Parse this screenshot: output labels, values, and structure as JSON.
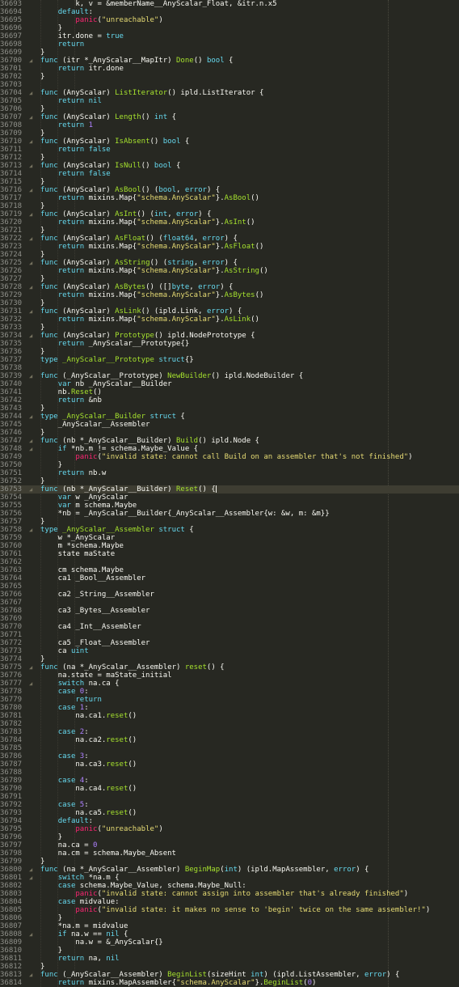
{
  "editor": {
    "first_line": 36693,
    "fold_marker": "◢",
    "current_line": 36753,
    "lines": [
      {
        "f": false,
        "c": "\t\tk, v = &memberName__AnyScalar_Float, &itr.n.x5"
      },
      {
        "f": false,
        "c": "\tdefault:"
      },
      {
        "f": false,
        "c": "\t\tpanic(\"unreachable\")"
      },
      {
        "f": false,
        "c": "\t}"
      },
      {
        "f": false,
        "c": "\titr.done = true"
      },
      {
        "f": false,
        "c": "\treturn"
      },
      {
        "f": false,
        "c": "}"
      },
      {
        "f": true,
        "c": "func (itr *_AnyScalar__MapItr) Done() bool {"
      },
      {
        "f": false,
        "c": "\treturn itr.done"
      },
      {
        "f": false,
        "c": "}"
      },
      {
        "f": false,
        "c": ""
      },
      {
        "f": true,
        "c": "func (AnyScalar) ListIterator() ipld.ListIterator {"
      },
      {
        "f": false,
        "c": "\treturn nil"
      },
      {
        "f": false,
        "c": "}"
      },
      {
        "f": true,
        "c": "func (AnyScalar) Length() int {"
      },
      {
        "f": false,
        "c": "\treturn 1"
      },
      {
        "f": false,
        "c": "}"
      },
      {
        "f": true,
        "c": "func (AnyScalar) IsAbsent() bool {"
      },
      {
        "f": false,
        "c": "\treturn false"
      },
      {
        "f": false,
        "c": "}"
      },
      {
        "f": true,
        "c": "func (AnyScalar) IsNull() bool {"
      },
      {
        "f": false,
        "c": "\treturn false"
      },
      {
        "f": false,
        "c": "}"
      },
      {
        "f": true,
        "c": "func (AnyScalar) AsBool() (bool, error) {"
      },
      {
        "f": false,
        "c": "\treturn mixins.Map{\"schema.AnyScalar\"}.AsBool()"
      },
      {
        "f": false,
        "c": "}"
      },
      {
        "f": true,
        "c": "func (AnyScalar) AsInt() (int, error) {"
      },
      {
        "f": false,
        "c": "\treturn mixins.Map{\"schema.AnyScalar\"}.AsInt()"
      },
      {
        "f": false,
        "c": "}"
      },
      {
        "f": true,
        "c": "func (AnyScalar) AsFloat() (float64, error) {"
      },
      {
        "f": false,
        "c": "\treturn mixins.Map{\"schema.AnyScalar\"}.AsFloat()"
      },
      {
        "f": false,
        "c": "}"
      },
      {
        "f": true,
        "c": "func (AnyScalar) AsString() (string, error) {"
      },
      {
        "f": false,
        "c": "\treturn mixins.Map{\"schema.AnyScalar\"}.AsString()"
      },
      {
        "f": false,
        "c": "}"
      },
      {
        "f": true,
        "c": "func (AnyScalar) AsBytes() ([]byte, error) {"
      },
      {
        "f": false,
        "c": "\treturn mixins.Map{\"schema.AnyScalar\"}.AsBytes()"
      },
      {
        "f": false,
        "c": "}"
      },
      {
        "f": true,
        "c": "func (AnyScalar) AsLink() (ipld.Link, error) {"
      },
      {
        "f": false,
        "c": "\treturn mixins.Map{\"schema.AnyScalar\"}.AsLink()"
      },
      {
        "f": false,
        "c": "}"
      },
      {
        "f": true,
        "c": "func (AnyScalar) Prototype() ipld.NodePrototype {"
      },
      {
        "f": false,
        "c": "\treturn _AnyScalar__Prototype{}"
      },
      {
        "f": false,
        "c": "}"
      },
      {
        "f": false,
        "c": "type _AnyScalar__Prototype struct{}"
      },
      {
        "f": false,
        "c": ""
      },
      {
        "f": true,
        "c": "func (_AnyScalar__Prototype) NewBuilder() ipld.NodeBuilder {"
      },
      {
        "f": false,
        "c": "\tvar nb _AnyScalar__Builder"
      },
      {
        "f": false,
        "c": "\tnb.Reset()"
      },
      {
        "f": false,
        "c": "\treturn &nb"
      },
      {
        "f": false,
        "c": "}"
      },
      {
        "f": true,
        "c": "type _AnyScalar__Builder struct {"
      },
      {
        "f": false,
        "c": "\t_AnyScalar__Assembler"
      },
      {
        "f": false,
        "c": "}"
      },
      {
        "f": true,
        "c": "func (nb *_AnyScalar__Builder) Build() ipld.Node {"
      },
      {
        "f": true,
        "c": "\tif *nb.m != schema.Maybe_Value {"
      },
      {
        "f": false,
        "c": "\t\tpanic(\"invalid state: cannot call Build on an assembler that's not finished\")"
      },
      {
        "f": false,
        "c": "\t}"
      },
      {
        "f": false,
        "c": "\treturn nb.w"
      },
      {
        "f": false,
        "c": "}"
      },
      {
        "f": true,
        "c": "func (nb *_AnyScalar__Builder) Reset() {"
      },
      {
        "f": false,
        "c": "\tvar w _AnyScalar"
      },
      {
        "f": false,
        "c": "\tvar m schema.Maybe"
      },
      {
        "f": false,
        "c": "\t*nb = _AnyScalar__Builder{_AnyScalar__Assembler{w: &w, m: &m}}"
      },
      {
        "f": false,
        "c": "}"
      },
      {
        "f": true,
        "c": "type _AnyScalar__Assembler struct {"
      },
      {
        "f": false,
        "c": "\tw *_AnyScalar"
      },
      {
        "f": false,
        "c": "\tm *schema.Maybe"
      },
      {
        "f": false,
        "c": "\tstate maState"
      },
      {
        "f": false,
        "c": ""
      },
      {
        "f": false,
        "c": "\tcm schema.Maybe"
      },
      {
        "f": false,
        "c": "\tca1 _Bool__Assembler"
      },
      {
        "f": false,
        "c": ""
      },
      {
        "f": false,
        "c": "\tca2 _String__Assembler"
      },
      {
        "f": false,
        "c": ""
      },
      {
        "f": false,
        "c": "\tca3 _Bytes__Assembler"
      },
      {
        "f": false,
        "c": ""
      },
      {
        "f": false,
        "c": "\tca4 _Int__Assembler"
      },
      {
        "f": false,
        "c": ""
      },
      {
        "f": false,
        "c": "\tca5 _Float__Assembler"
      },
      {
        "f": false,
        "c": "\tca uint"
      },
      {
        "f": false,
        "c": "}"
      },
      {
        "f": true,
        "c": "func (na *_AnyScalar__Assembler) reset() {"
      },
      {
        "f": false,
        "c": "\tna.state = maState_initial"
      },
      {
        "f": true,
        "c": "\tswitch na.ca {"
      },
      {
        "f": false,
        "c": "\tcase 0:"
      },
      {
        "f": false,
        "c": "\t\treturn"
      },
      {
        "f": false,
        "c": "\tcase 1:"
      },
      {
        "f": false,
        "c": "\t\tna.ca1.reset()"
      },
      {
        "f": false,
        "c": ""
      },
      {
        "f": false,
        "c": "\tcase 2:"
      },
      {
        "f": false,
        "c": "\t\tna.ca2.reset()"
      },
      {
        "f": false,
        "c": ""
      },
      {
        "f": false,
        "c": "\tcase 3:"
      },
      {
        "f": false,
        "c": "\t\tna.ca3.reset()"
      },
      {
        "f": false,
        "c": ""
      },
      {
        "f": false,
        "c": "\tcase 4:"
      },
      {
        "f": false,
        "c": "\t\tna.ca4.reset()"
      },
      {
        "f": false,
        "c": ""
      },
      {
        "f": false,
        "c": "\tcase 5:"
      },
      {
        "f": false,
        "c": "\t\tna.ca5.reset()"
      },
      {
        "f": false,
        "c": "\tdefault:"
      },
      {
        "f": false,
        "c": "\t\tpanic(\"unreachable\")"
      },
      {
        "f": false,
        "c": "\t}"
      },
      {
        "f": false,
        "c": "\tna.ca = 0"
      },
      {
        "f": false,
        "c": "\tna.cm = schema.Maybe_Absent"
      },
      {
        "f": false,
        "c": "}"
      },
      {
        "f": true,
        "c": "func (na *_AnyScalar__Assembler) BeginMap(int) (ipld.MapAssembler, error) {"
      },
      {
        "f": true,
        "c": "\tswitch *na.m {"
      },
      {
        "f": false,
        "c": "\tcase schema.Maybe_Value, schema.Maybe_Null:"
      },
      {
        "f": false,
        "c": "\t\tpanic(\"invalid state: cannot assign into assembler that's already finished\")"
      },
      {
        "f": false,
        "c": "\tcase midvalue:"
      },
      {
        "f": false,
        "c": "\t\tpanic(\"invalid state: it makes no sense to 'begin' twice on the same assembler!\")"
      },
      {
        "f": false,
        "c": "\t}"
      },
      {
        "f": false,
        "c": "\t*na.m = midvalue"
      },
      {
        "f": true,
        "c": "\tif na.w == nil {"
      },
      {
        "f": false,
        "c": "\t\tna.w = &_AnyScalar{}"
      },
      {
        "f": false,
        "c": "\t}"
      },
      {
        "f": false,
        "c": "\treturn na, nil"
      },
      {
        "f": false,
        "c": "}"
      },
      {
        "f": true,
        "c": "func (_AnyScalar__Assembler) BeginList(sizeHint int) (ipld.ListAssembler, error) {"
      },
      {
        "f": false,
        "c": "\treturn mixins.MapAssembler{\"schema.AnyScalar\"}.BeginList(0)"
      },
      {
        "f": false,
        "c": "}"
      }
    ]
  }
}
